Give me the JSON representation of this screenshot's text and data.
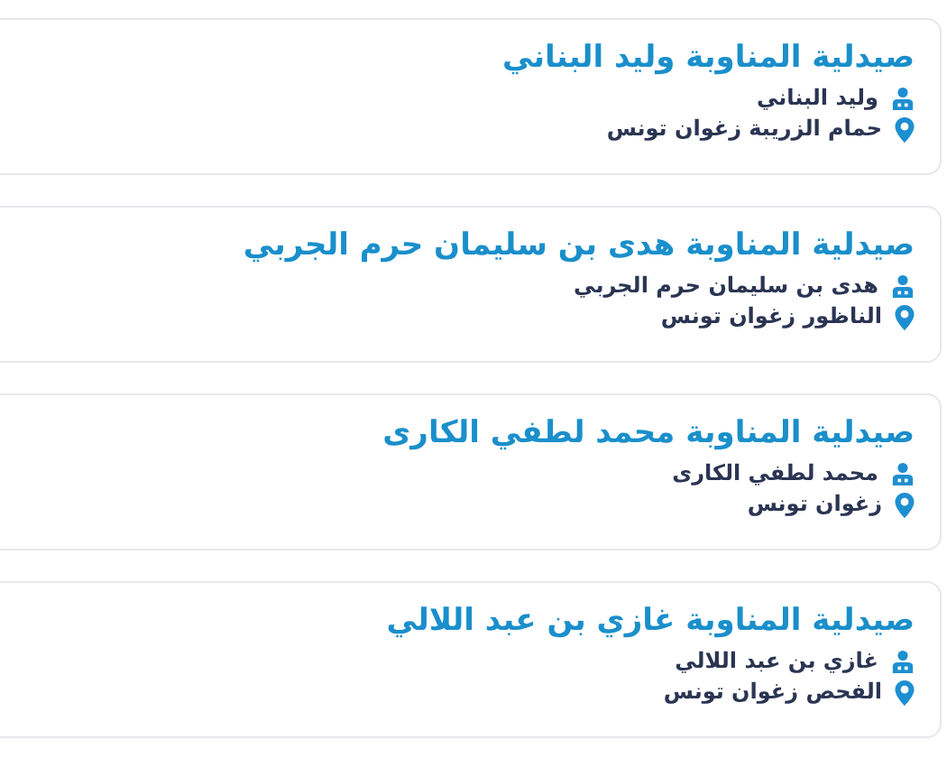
{
  "pharmacies": [
    {
      "title": "صيدلية المناوبة وليد البناني",
      "owner": "وليد البناني",
      "address": "حمام الزريبة زغوان تونس"
    },
    {
      "title": "صيدلية المناوبة هدى بن سليمان حرم الجربي",
      "owner": "هدى بن سليمان حرم الجربي",
      "address": "الناظور زغوان تونس"
    },
    {
      "title": "صيدلية المناوبة محمد لطفي الكارى",
      "owner": "محمد لطفي الكارى",
      "address": "زغوان تونس"
    },
    {
      "title": "صيدلية المناوبة غازي بن عبد اللالي",
      "owner": "غازي بن عبد اللالي",
      "address": "الفحص زغوان تونس"
    }
  ]
}
